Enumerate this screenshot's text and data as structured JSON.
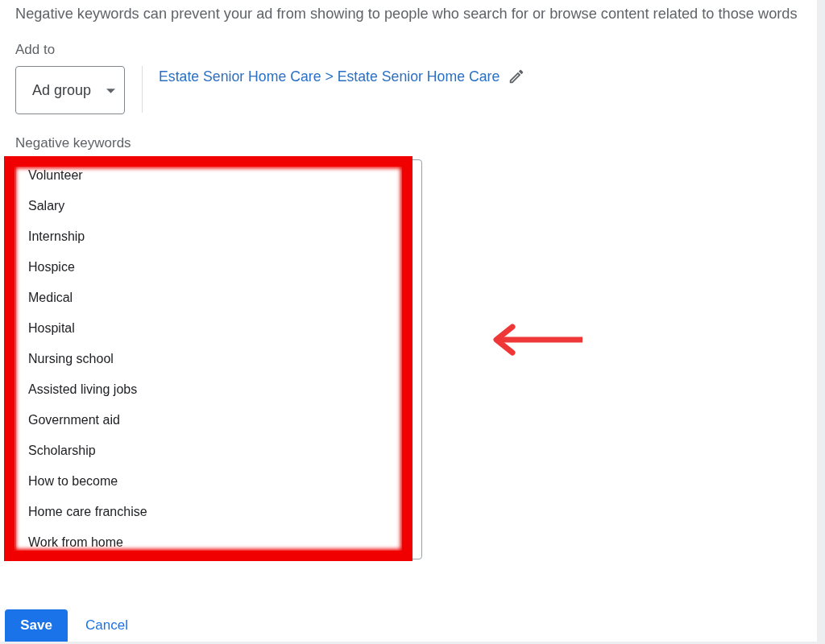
{
  "description": "Negative keywords can prevent your ad from showing to people who search for or browse content related to those words",
  "add_to": {
    "label": "Add to",
    "dropdown": {
      "value": "Ad group"
    },
    "target": "Estate Senior Home Care > Estate Senior Home Care"
  },
  "negative_keywords": {
    "label": "Negative keywords",
    "keywords": [
      "Volunteer",
      "Salary",
      "Internship",
      "Hospice",
      "Medical",
      "Hospital",
      "Nursing school",
      "Assisted living jobs",
      "Government aid",
      "Scholarship",
      "How to become",
      "Home care franchise",
      "Work from home"
    ]
  },
  "annotations": {
    "highlight_frame": true,
    "arrow": true
  },
  "buttons": [
    {
      "label": "Save",
      "kind": "primary"
    },
    {
      "label": "Cancel",
      "kind": "text"
    }
  ]
}
